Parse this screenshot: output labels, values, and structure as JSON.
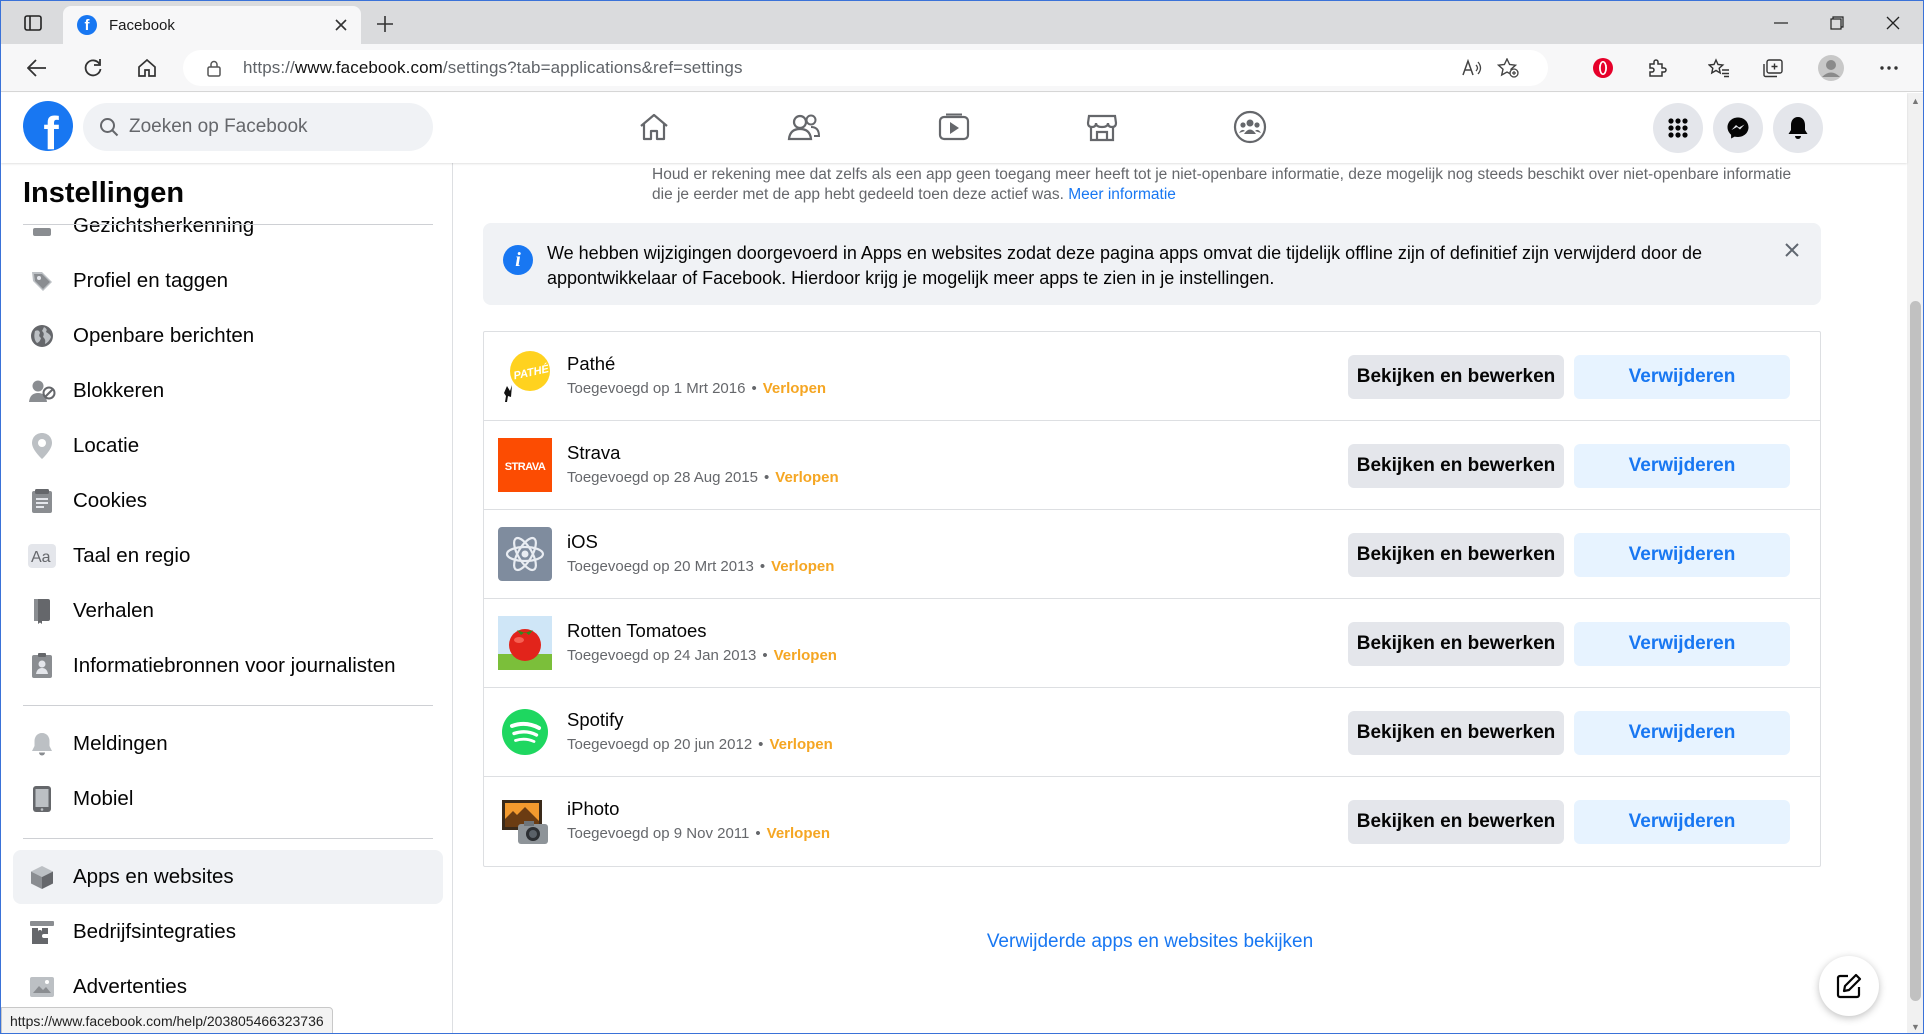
{
  "browser": {
    "tab_title": "Facebook",
    "tab_favicon": "f",
    "url_scheme": "https://",
    "url_host": "www.facebook.com",
    "url_rest": "/settings?tab=applications&ref=settings",
    "status_url": "https://www.facebook.com/help/203805466323736"
  },
  "fb": {
    "logo": "f",
    "search_placeholder": "Zoeken op Facebook"
  },
  "sidebar": {
    "title": "Instellingen",
    "partial_item": "Gezichtsherkenning",
    "items": [
      {
        "label": "Profiel en taggen",
        "icon": "tag-icon"
      },
      {
        "label": "Openbare berichten",
        "icon": "globe-icon"
      },
      {
        "label": "Blokkeren",
        "icon": "block-user-icon"
      },
      {
        "label": "Locatie",
        "icon": "location-pin-icon"
      },
      {
        "label": "Cookies",
        "icon": "cookies-icon"
      },
      {
        "label": "Taal en regio",
        "icon": "language-icon"
      },
      {
        "label": "Verhalen",
        "icon": "book-icon"
      },
      {
        "label": "Informatiebronnen voor journalisten",
        "icon": "journalist-icon"
      }
    ],
    "items2": [
      {
        "label": "Meldingen",
        "icon": "bell-icon"
      },
      {
        "label": "Mobiel",
        "icon": "phone-icon"
      }
    ],
    "items3": [
      {
        "label": "Apps en websites",
        "icon": "cube-icon"
      },
      {
        "label": "Bedrijfsintegraties",
        "icon": "business-integrations-icon"
      },
      {
        "label": "Advertenties",
        "icon": "ads-icon"
      }
    ]
  },
  "main": {
    "note": "Houd er rekening mee dat zelfs als een app geen toegang meer heeft tot je niet-openbare informatie, deze mogelijk nog steeds beschikt over niet-openbare informatie die je eerder met de app hebt gedeeld toen deze actief was.",
    "note_link": "Meer informatie",
    "banner_text": "We hebben wijzigingen doorgevoerd in Apps en websites zodat deze pagina apps omvat die tijdelijk offline zijn of definitief zijn verwijderd door de appontwikkelaar of Facebook. Hierdoor krijg je mogelijk meer apps te zien in je instellingen.",
    "edit_label": "Bekijken en bewerken",
    "remove_label": "Verwijderen",
    "expired_label": "Verlopen",
    "apps": [
      {
        "name": "Pathé",
        "added": "Toegevoegd op 1 Mrt 2016"
      },
      {
        "name": "Strava",
        "added": "Toegevoegd op 28 Aug 2015"
      },
      {
        "name": "iOS",
        "added": "Toegevoegd op 20 Mrt 2013"
      },
      {
        "name": "Rotten Tomatoes",
        "added": "Toegevoegd op 24 Jan 2013"
      },
      {
        "name": "Spotify",
        "added": "Toegevoegd op 20 jun 2012"
      },
      {
        "name": "iPhoto",
        "added": "Toegevoegd op 9 Nov 2011"
      }
    ],
    "strava_logo_text": "STRAVA",
    "pathe_logo_text": "PATHÉ",
    "removed_link": "Verwijderde apps en websites bekijken"
  },
  "colors": {
    "fb_blue": "#1877f2",
    "expired": "#f5a623",
    "strava": "#fc4c02",
    "spotify": "#1ed760"
  }
}
